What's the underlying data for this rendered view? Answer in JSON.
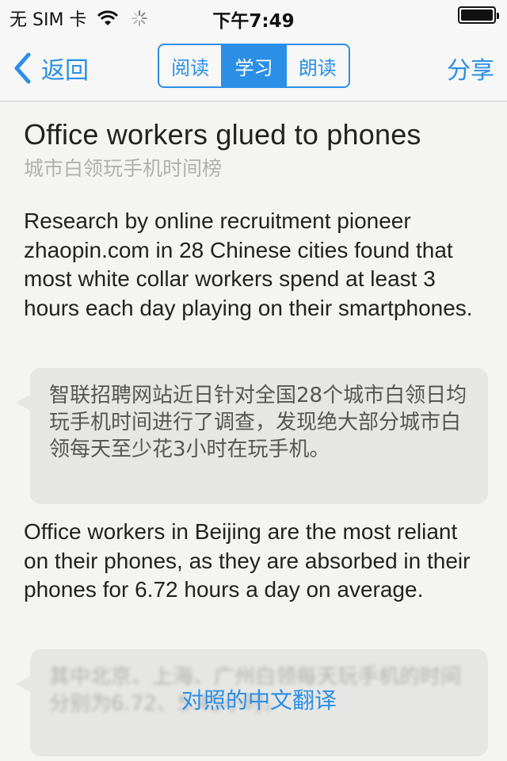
{
  "status_bar": {
    "carrier": "无 SIM 卡",
    "time": "下午7:49"
  },
  "nav": {
    "back_label": "返回",
    "segments": [
      {
        "label": "阅读",
        "active": false
      },
      {
        "label": "学习",
        "active": true
      },
      {
        "label": "朗读",
        "active": false
      }
    ],
    "share_label": "分享"
  },
  "article": {
    "title": "Office workers glued to phones",
    "subtitle": "城市白领玩手机时间榜",
    "paragraphs": [
      {
        "english": "Research by online recruitment pioneer zhaopin.com in 28 Chinese cities found that most white collar workers spend at least 3 hours each day playing on their smartphones.",
        "chinese": "智联招聘网站近日针对全国28个城市白领日均玩手机时间进行了调查，发现绝大部分城市白领每天至少花3小时在玩手机。"
      },
      {
        "english": "Office workers in Beijing are the most reliant on their phones, as they are absorbed in their phones for 6.72 hours a day on average.",
        "chinese": "其中北京、上海、广州白领每天玩手机的时间分别为6.72、5.45小时。",
        "reveal_label": "对照的中文翻译"
      }
    ]
  },
  "colors": {
    "accent": "#2b8fe6",
    "bubble": "#e6e6e4",
    "background": "#f4f4f2"
  }
}
